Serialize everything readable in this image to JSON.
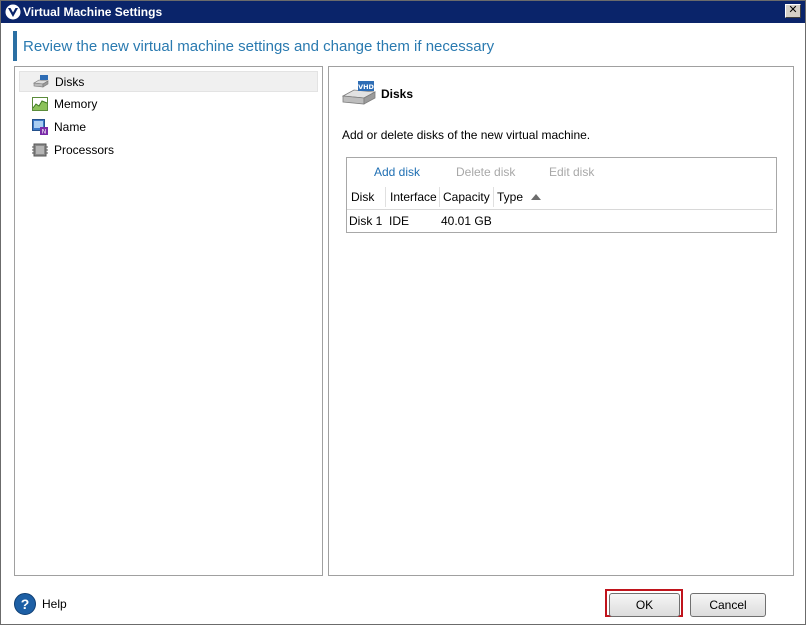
{
  "window": {
    "title": "Virtual Machine Settings",
    "close_label": "✕"
  },
  "header": {
    "text": "Review the new virtual machine settings and change them if necessary"
  },
  "nav": {
    "items": [
      {
        "label": "Disks",
        "icon": "hard-disk-icon",
        "selected": true
      },
      {
        "label": "Memory",
        "icon": "memory-chart-icon",
        "selected": false
      },
      {
        "label": "Name",
        "icon": "vm-name-icon",
        "selected": false
      },
      {
        "label": "Processors",
        "icon": "processor-chip-icon",
        "selected": false
      }
    ]
  },
  "disks": {
    "title": "Disks",
    "description": "Add or delete disks of the new virtual machine.",
    "toolbar": {
      "add": "Add disk",
      "delete": "Delete disk",
      "edit": "Edit disk"
    },
    "columns": [
      "Disk",
      "Interface",
      "Capacity",
      "Type"
    ],
    "sort": {
      "column": "Type",
      "direction": "ascending"
    },
    "rows": [
      {
        "disk": "Disk 1",
        "interface": "IDE",
        "capacity": "40.01 GB",
        "type": ""
      }
    ]
  },
  "footer": {
    "help": "Help",
    "help_icon_glyph": "?",
    "ok": "OK",
    "cancel": "Cancel"
  },
  "colors": {
    "titlebar": "#0a246a",
    "header_text": "#2a7ab0",
    "link": "#1f6fb3",
    "highlight": "#c0141c"
  }
}
